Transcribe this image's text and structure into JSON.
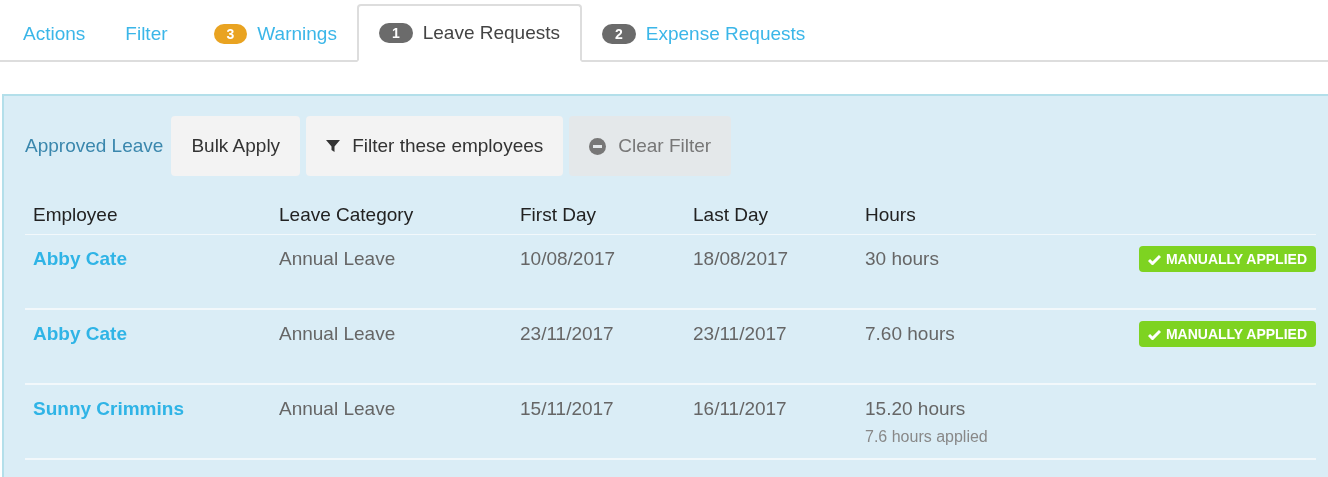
{
  "tabs": [
    {
      "label": "Actions",
      "selected": false
    },
    {
      "label": "Filter",
      "selected": false
    },
    {
      "label": "Warnings",
      "badge": "3",
      "color": "#e9a321",
      "selected": false
    },
    {
      "label": "Leave Requests",
      "badge": "1",
      "color": "#6b6b6b",
      "selected": true
    },
    {
      "label": "Expense Requests",
      "badge": "2",
      "color": "#6b6b6b",
      "selected": false
    }
  ],
  "panel": {
    "title": "Approved Leave",
    "buttons": [
      {
        "label": "Bulk Apply",
        "kind": "plain",
        "disabled": false
      },
      {
        "label": "Filter these employees",
        "kind": "filter",
        "disabled": false
      },
      {
        "label": "Clear Filter",
        "kind": "clear",
        "disabled": true
      }
    ],
    "table": {
      "columns": [
        "Employee",
        "Leave Category",
        "First Day",
        "Last Day",
        "Hours"
      ],
      "rows": [
        {
          "employee": "Abby Cate",
          "category": "Annual Leave",
          "first_day": "10/08/2017",
          "last_day": "18/08/2017",
          "hours": "30 hours",
          "status": "MANUALLY APPLIED"
        },
        {
          "employee": "Abby Cate",
          "category": "Annual Leave",
          "first_day": "23/11/2017",
          "last_day": "23/11/2017",
          "hours": "7.60 hours",
          "status": "MANUALLY APPLIED"
        },
        {
          "employee": "Sunny Crimmins",
          "category": "Annual Leave",
          "first_day": "15/11/2017",
          "last_day": "16/11/2017",
          "hours": "15.20 hours",
          "note": "7.6 hours applied"
        }
      ]
    }
  }
}
